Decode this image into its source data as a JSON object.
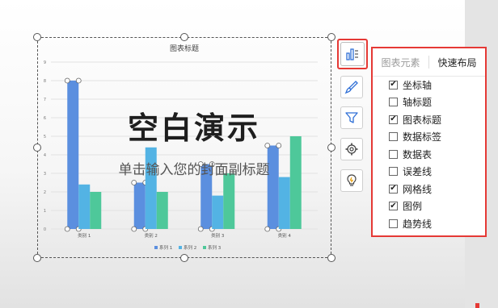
{
  "slide": {
    "title": "空白演示",
    "subtitle": "单击输入您的封面副标题"
  },
  "chart_data": {
    "type": "bar",
    "title": "图表标题",
    "categories": [
      "类别 1",
      "类别 2",
      "类别 3",
      "类别 4"
    ],
    "series": [
      {
        "name": "系列 1",
        "values": [
          8,
          2.5,
          3.5,
          4.5
        ],
        "color": "#5b8fdf"
      },
      {
        "name": "系列 2",
        "values": [
          2.4,
          4.4,
          1.8,
          2.8
        ],
        "color": "#53b3e4"
      },
      {
        "name": "系列 3",
        "values": [
          2,
          2,
          3,
          5
        ],
        "color": "#4ec89a"
      }
    ],
    "ylim": [
      0,
      9
    ],
    "yticks": [
      "0",
      "1",
      "2",
      "3",
      "4",
      "5",
      "6",
      "7",
      "8",
      "9"
    ],
    "grid": true,
    "legend": "bottom"
  },
  "toolbar": {
    "buttons": [
      {
        "name": "chart-elements-button",
        "icon": "bar-chart-icon",
        "active": true
      },
      {
        "name": "chart-style-button",
        "icon": "brush-icon"
      },
      {
        "name": "chart-filter-button",
        "icon": "filter-icon"
      },
      {
        "name": "chart-settings-button",
        "icon": "gear-icon"
      },
      {
        "name": "chart-tips-button",
        "icon": "lightbulb-icon"
      }
    ]
  },
  "panel": {
    "tabs": [
      {
        "label": "图表元素",
        "active": false
      },
      {
        "label": "快速布局",
        "active": true
      }
    ],
    "options": [
      {
        "label": "坐标轴",
        "checked": true
      },
      {
        "label": "轴标题",
        "checked": false
      },
      {
        "label": "图表标题",
        "checked": true
      },
      {
        "label": "数据标签",
        "checked": false
      },
      {
        "label": "数据表",
        "checked": false
      },
      {
        "label": "误差线",
        "checked": false
      },
      {
        "label": "网格线",
        "checked": true
      },
      {
        "label": "图例",
        "checked": true
      },
      {
        "label": "趋势线",
        "checked": false
      }
    ]
  },
  "colors": {
    "accent_red": "#e53935"
  }
}
